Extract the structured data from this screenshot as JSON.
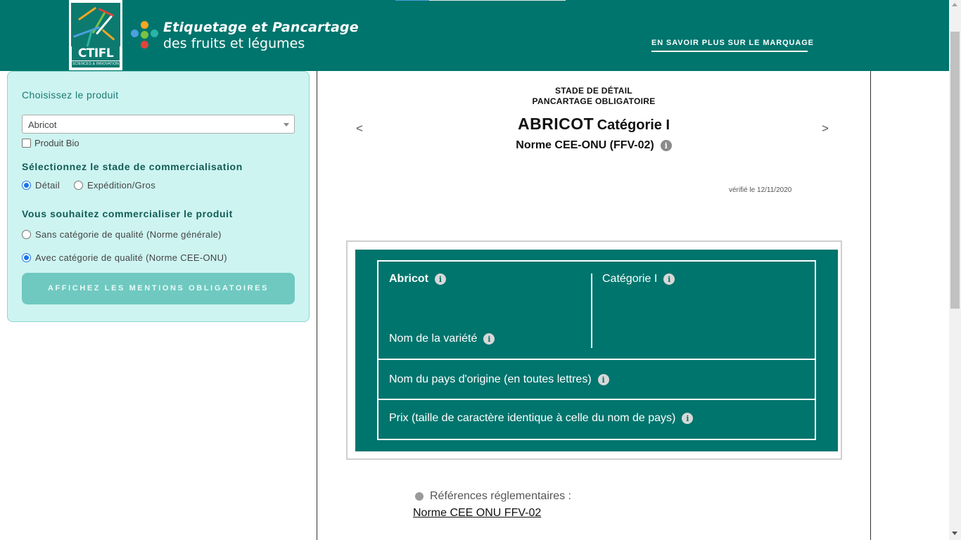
{
  "header": {
    "brand_line1": "Etiquetage et Pancartage",
    "brand_line2": "des fruits et légumes",
    "logo_text": "CTIFL",
    "logo_subtext": "SCIENCES & INNOVATION",
    "link_label": "EN SAVOIR PLUS SUR LE MARQUAGE"
  },
  "colors": {
    "brand_green": "#00756d",
    "sidebar_bg": "#cdf4f1",
    "button_bg": "#6fc9c0",
    "dot_colors": [
      "#f5a623",
      "#4aa0e0",
      "#7ac143",
      "#2ab3a6",
      "#e0453a"
    ]
  },
  "sidebar": {
    "choose_product_label": "Choisissez le produit",
    "selected_product": "Abricot",
    "bio_label": "Produit Bio",
    "stage_heading": "Sélectionnez le stade de commercialisation",
    "stage_options": [
      {
        "label": "Détail",
        "selected": true
      },
      {
        "label": "Expédition/Gros",
        "selected": false
      }
    ],
    "market_heading": "Vous souhaitez commercialiser le produit",
    "quality_options": [
      {
        "label": "Sans catégorie de qualité (Norme générale)",
        "selected": false
      },
      {
        "label": "Avec catégorie de qualité (Norme CEE-ONU)",
        "selected": true
      }
    ],
    "button_label": "AFFICHEZ LES MENTIONS OBLIGATOIRES"
  },
  "main": {
    "stage_line1": "STADE DE DÉTAIL",
    "stage_line2": "PANCARTAGE OBLIGATOIRE",
    "product_title": "ABRICOT",
    "category_title": "Catégorie I",
    "norm": "Norme CEE-ONU (FFV-02)",
    "prev_symbol": "<",
    "next_symbol": ">",
    "verified": "vérifié le 12/11/2020",
    "label": {
      "product": "Abricot",
      "category": "Catégorie I",
      "variety": "Nom de la variété",
      "origin": "Nom du pays d'origine (en toutes lettres)",
      "price": "Prix (taille de caractère identique à celle du nom de pays)"
    },
    "references_label": "Références réglementaires :",
    "reference_link": "Norme CEE ONU FFV-02"
  }
}
